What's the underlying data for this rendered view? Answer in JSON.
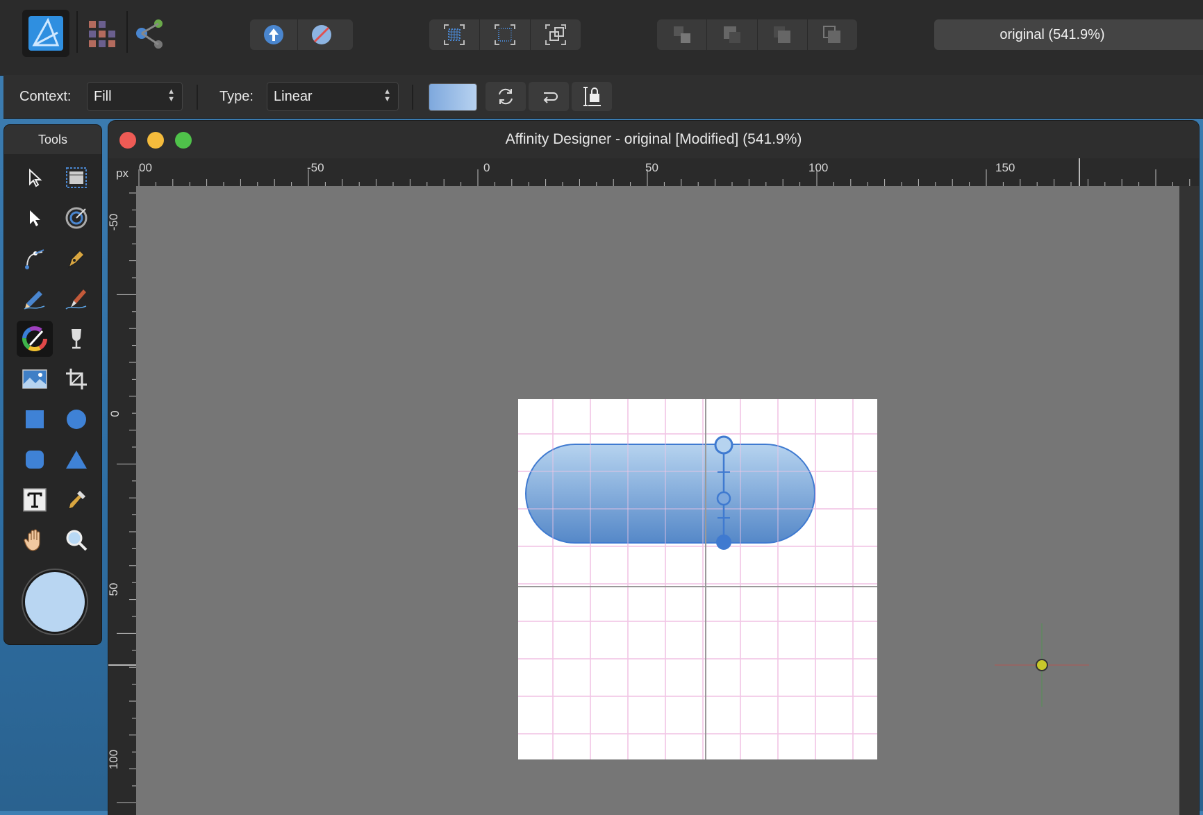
{
  "toolbar": {
    "persona_icon": "designer-persona-icon",
    "zoom_label": "original (541.9%)",
    "groups": {
      "persona_buttons": [
        "pixel-persona-icon",
        "export-persona-icon"
      ],
      "snapping_buttons": [
        "assistant-icon",
        "no-assistant-icon"
      ],
      "grid_buttons": [
        "pixel-grid-icon",
        "dotted-grid-icon",
        "transform-icon"
      ],
      "arrange_buttons": [
        "move-back-icon",
        "move-back-one-icon",
        "move-forward-one-icon",
        "move-front-icon"
      ]
    }
  },
  "context_bar": {
    "context_label": "Context:",
    "context_value": "Fill",
    "type_label": "Type:",
    "type_value": "Linear",
    "gradient_preview_color_start": "#7ea8dd",
    "gradient_preview_color_end": "#b7d2f0"
  },
  "tools_panel": {
    "title": "Tools",
    "color_well": "#b9d6f2"
  },
  "document": {
    "title": "Affinity Designer - original [Modified] (541.9%)",
    "ruler_unit": "px",
    "h_ruler_labels": [
      "00",
      "-50",
      "0",
      "50",
      "100",
      "150"
    ],
    "v_ruler_labels": [
      "-50",
      "0",
      "50",
      "100"
    ]
  },
  "colors": {
    "accent": "#4a86cf",
    "artboard_bg": "#ffffff",
    "grid_line": "#f2c6e6",
    "shape_top": "#b6d3ef",
    "shape_bottom": "#5588c8",
    "traffic_red": "#ee5b55",
    "traffic_yellow": "#f4bb3c",
    "traffic_green": "#4fc24a"
  }
}
